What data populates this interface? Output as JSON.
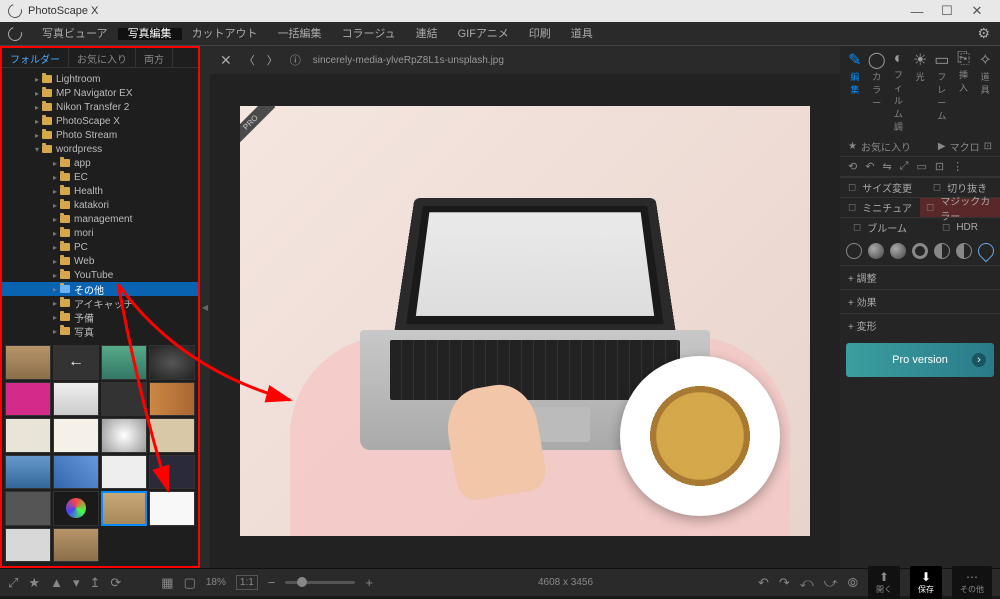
{
  "titlebar": {
    "app_name": "PhotoScape X"
  },
  "maintabs": [
    "写真ビューア",
    "写真編集",
    "カットアウト",
    "一括編集",
    "コラージュ",
    "連結",
    "GIFアニメ",
    "印刷",
    "道具"
  ],
  "maintabs_active_index": 1,
  "folder_tabs": [
    "フォルダー",
    "お気に入り",
    "両方"
  ],
  "folder_tabs_active_index": 0,
  "tree": [
    {
      "level": 1,
      "label": "Lightroom",
      "expanded": false
    },
    {
      "level": 1,
      "label": "MP Navigator EX",
      "expanded": false
    },
    {
      "level": 1,
      "label": "Nikon Transfer 2",
      "expanded": false
    },
    {
      "level": 1,
      "label": "PhotoScape X",
      "expanded": false
    },
    {
      "level": 1,
      "label": "Photo Stream",
      "expanded": false
    },
    {
      "level": 1,
      "label": "wordpress",
      "expanded": true
    },
    {
      "level": 2,
      "label": "app",
      "expanded": false
    },
    {
      "level": 2,
      "label": "EC",
      "expanded": false
    },
    {
      "level": 2,
      "label": "Health",
      "expanded": false
    },
    {
      "level": 2,
      "label": "katakori",
      "expanded": false
    },
    {
      "level": 2,
      "label": "management",
      "expanded": false
    },
    {
      "level": 2,
      "label": "mori",
      "expanded": false
    },
    {
      "level": 2,
      "label": "PC",
      "expanded": false
    },
    {
      "level": 2,
      "label": "Web",
      "expanded": false
    },
    {
      "level": 2,
      "label": "YouTube",
      "expanded": false
    },
    {
      "level": 2,
      "label": "その他",
      "expanded": false,
      "selected": true
    },
    {
      "level": 2,
      "label": "アイキャッチ",
      "expanded": false
    },
    {
      "level": 2,
      "label": "予備",
      "expanded": false
    },
    {
      "level": 2,
      "label": "写真",
      "expanded": false
    }
  ],
  "thumb_count": 22,
  "thumb_selected_index": 18,
  "center": {
    "filename": "sincerely-media-ylveRpZ8L1s-unsplash.jpg",
    "pro_badge": "PRO"
  },
  "right": {
    "top_btns": [
      {
        "icon": "✎",
        "label": "編集",
        "active": true
      },
      {
        "icon": "◯",
        "label": "カラー"
      },
      {
        "icon": "◐",
        "label": "フィルム調"
      },
      {
        "icon": "☀",
        "label": "光"
      },
      {
        "icon": "▭",
        "label": "フレーム"
      },
      {
        "icon": "⎘",
        "label": "挿入"
      },
      {
        "icon": "✧",
        "label": "道具"
      }
    ],
    "macro": {
      "fav": "お気に入り",
      "play": "▶",
      "label": "マクロ"
    },
    "row_icons": [
      "⟲",
      "↶",
      "⇋",
      "⤢",
      "▭",
      "⊡",
      "⋮"
    ],
    "pairs": [
      [
        "サイズ変更",
        "切り抜き"
      ],
      [
        "ミニチュア",
        "マジックカラー"
      ],
      [
        "ブルーム",
        "HDR"
      ]
    ],
    "pair_highlight_index": 1,
    "accordions": [
      "調整",
      "効果",
      "変形"
    ],
    "pro_banner": "Pro version"
  },
  "bottom": {
    "zoom_pct": "18%",
    "ratio": "1:1",
    "dimensions": "4608 x 3456",
    "undo": "元に戻す",
    "redo": "やり直す",
    "open": "開く",
    "save": "保存",
    "more": "その他"
  }
}
